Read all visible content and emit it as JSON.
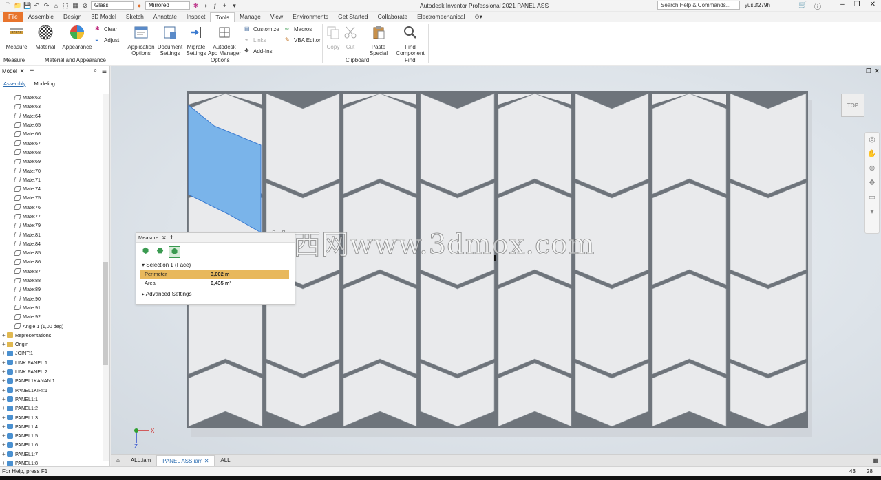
{
  "window": {
    "title": "Autodesk Inventor Professional 2021    PANEL ASS",
    "search_placeholder": "Search Help & Commands...",
    "user": "yusuf279h",
    "material_dropdown": "Glass",
    "appearance_dropdown": "Mirrored"
  },
  "menu": [
    "File",
    "Assemble",
    "Design",
    "3D Model",
    "Sketch",
    "Annotate",
    "Inspect",
    "Tools",
    "Manage",
    "View",
    "Environments",
    "Get Started",
    "Collaborate",
    "Electromechanical"
  ],
  "ribbon": {
    "measure": "Measure",
    "material": "Material",
    "appearance": "Appearance",
    "clear": "Clear",
    "adjust": "Adjust",
    "application_options": "Application\nOptions",
    "document_settings": "Document\nSettings",
    "migrate_settings": "Migrate\nSettings",
    "app_manager": "Autodesk\nApp Manager",
    "customize": "Customize",
    "links": "Links",
    "add_ins": "Add-Ins",
    "macros": "Macros",
    "vba_editor": "VBA Editor",
    "copy": "Copy",
    "cut": "Cut",
    "paste_special": "Paste\nSpecial",
    "find_component": "Find\nComponent",
    "groups": {
      "measure": "Measure",
      "material_appearance": "Material and Appearance",
      "options": "Options",
      "clipboard": "Clipboard",
      "find": "Find"
    }
  },
  "browser": {
    "header": "Model",
    "tab_assembly": "Assembly",
    "tab_modeling": "Modeling",
    "items": [
      {
        "label": "Mate:62",
        "type": "mate"
      },
      {
        "label": "Mate:63",
        "type": "mate"
      },
      {
        "label": "Mate:64",
        "type": "mate"
      },
      {
        "label": "Mate:65",
        "type": "mate"
      },
      {
        "label": "Mate:66",
        "type": "mate"
      },
      {
        "label": "Mate:67",
        "type": "mate"
      },
      {
        "label": "Mate:68",
        "type": "mate"
      },
      {
        "label": "Mate:69",
        "type": "mate"
      },
      {
        "label": "Mate:70",
        "type": "mate"
      },
      {
        "label": "Mate:71",
        "type": "mate"
      },
      {
        "label": "Mate:74",
        "type": "mate"
      },
      {
        "label": "Mate:75",
        "type": "mate"
      },
      {
        "label": "Mate:76",
        "type": "mate"
      },
      {
        "label": "Mate:77",
        "type": "mate"
      },
      {
        "label": "Mate:79",
        "type": "mate"
      },
      {
        "label": "Mate:81",
        "type": "mate"
      },
      {
        "label": "Mate:84",
        "type": "mate"
      },
      {
        "label": "Mate:85",
        "type": "mate"
      },
      {
        "label": "Mate:86",
        "type": "mate"
      },
      {
        "label": "Mate:87",
        "type": "mate"
      },
      {
        "label": "Mate:88",
        "type": "mate"
      },
      {
        "label": "Mate:89",
        "type": "mate"
      },
      {
        "label": "Mate:90",
        "type": "mate"
      },
      {
        "label": "Mate:91",
        "type": "mate"
      },
      {
        "label": "Mate:92",
        "type": "mate"
      },
      {
        "label": "Angle:1 (1,00 deg)",
        "type": "angle"
      },
      {
        "label": "Representations",
        "type": "folder",
        "expand": true,
        "root": true
      },
      {
        "label": "Origin",
        "type": "folder",
        "expand": true,
        "root": true
      },
      {
        "label": "JOINT:1",
        "type": "part",
        "expand": true,
        "root": true
      },
      {
        "label": "LINK PANEL:1",
        "type": "part",
        "expand": true,
        "root": true
      },
      {
        "label": "LINK PANEL:2",
        "type": "part",
        "expand": true,
        "root": true
      },
      {
        "label": "PANEL1KANAN:1",
        "type": "sub",
        "expand": true,
        "root": true
      },
      {
        "label": "PANEL1KIRI:1",
        "type": "sub",
        "expand": true,
        "root": true
      },
      {
        "label": "PANEL1:1",
        "type": "part",
        "expand": true,
        "root": true
      },
      {
        "label": "PANEL1:2",
        "type": "part",
        "expand": true,
        "root": true
      },
      {
        "label": "PANEL1:3",
        "type": "part",
        "expand": true,
        "root": true
      },
      {
        "label": "PANEL1:4",
        "type": "part",
        "expand": true,
        "root": true
      },
      {
        "label": "PANEL1:5",
        "type": "part",
        "expand": true,
        "root": true
      },
      {
        "label": "PANEL1:6",
        "type": "part",
        "expand": true,
        "root": true
      },
      {
        "label": "PANEL1:7",
        "type": "part",
        "expand": true,
        "root": true
      },
      {
        "label": "PANEL1:8",
        "type": "part",
        "expand": true,
        "root": true
      }
    ]
  },
  "measure_panel": {
    "title": "Measure",
    "selection": "Selection 1 (Face)",
    "perimeter_label": "Perimeter",
    "perimeter_value": "3,002 m",
    "area_label": "Area",
    "area_value": "0,435 m²",
    "advanced": "Advanced Settings"
  },
  "viewcube": "TOP",
  "watermark": "莫西网www.3dmox.com",
  "doc_tabs": [
    "ALL.iam",
    "PANEL ASS.iam",
    "ALL"
  ],
  "status": {
    "help": "For Help, press F1",
    "n1": "43",
    "n2": "28"
  },
  "colors": {
    "file_tab": "#e8742c",
    "selection": "#7ab4ea",
    "highlight_row": "#e8b85c",
    "accent": "#2b6cb0"
  }
}
